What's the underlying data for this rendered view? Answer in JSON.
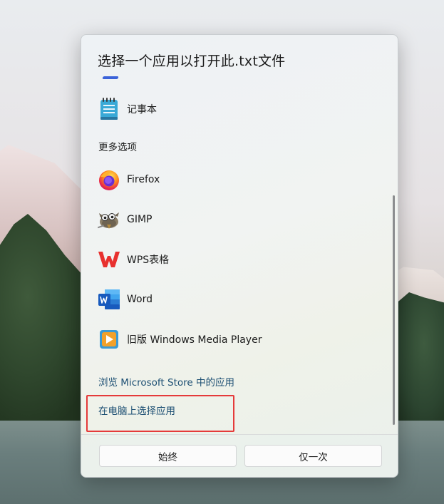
{
  "dialog": {
    "title": "选择一个应用以打开此.txt文件"
  },
  "suggested": [
    {
      "label": "记事本",
      "icon": "notepad-icon"
    }
  ],
  "more_options": {
    "label": "更多选项",
    "items": [
      {
        "label": "Firefox",
        "icon": "firefox-icon"
      },
      {
        "label": "GIMP",
        "icon": "gimp-icon"
      },
      {
        "label": "WPS表格",
        "icon": "wps-icon"
      },
      {
        "label": "Word",
        "icon": "word-icon"
      },
      {
        "label": "旧版 Windows Media Player",
        "icon": "windows-media-player-icon"
      }
    ]
  },
  "links": {
    "store": "浏览 Microsoft Store 中的应用",
    "choose_on_pc": "在电脑上选择应用"
  },
  "buttons": {
    "always": "始终",
    "just_once": "仅一次"
  },
  "colors": {
    "link": "#1b4e72",
    "highlight_border": "#e53a3a",
    "accent": "#3b63d9"
  }
}
